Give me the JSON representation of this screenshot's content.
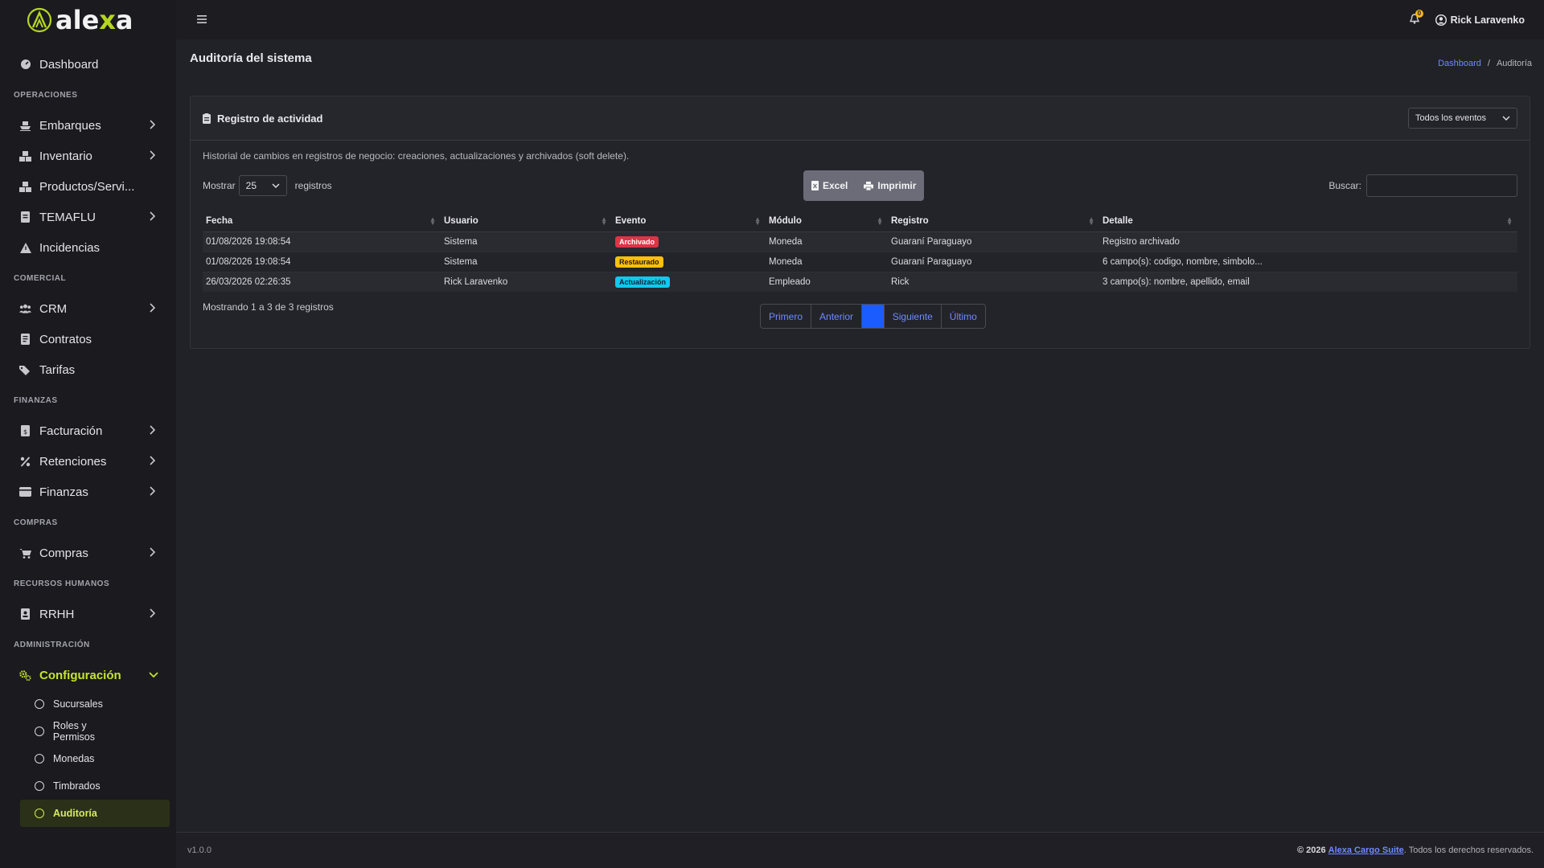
{
  "brand": {
    "name_start": "ale",
    "name_x": "x",
    "name_end": "a"
  },
  "topbar": {
    "notifications_count": "0",
    "user_name": "Rick Laravenko"
  },
  "sidebar": {
    "dashboard": "Dashboard",
    "sections": {
      "operaciones": "OPERACIONES",
      "comercial": "COMERCIAL",
      "finanzas": "FINANZAS",
      "compras": "COMPRAS",
      "rrhh": "RECURSOS HUMANOS",
      "admin": "ADMINISTRACIÓN"
    },
    "items": {
      "embarques": "Embarques",
      "inventario": "Inventario",
      "productos": "Productos/Servi...",
      "temaflu": "TEMAFLU",
      "incidencias": "Incidencias",
      "crm": "CRM",
      "contratos": "Contratos",
      "tarifas": "Tarifas",
      "facturacion": "Facturación",
      "retenciones": "Retenciones",
      "finanzas": "Finanzas",
      "compras": "Compras",
      "rrhh": "RRHH",
      "configuracion": "Configuración"
    },
    "sub": {
      "sucursales": "Sucursales",
      "roles": "Roles y Permisos",
      "monedas": "Monedas",
      "timbrados": "Timbrados",
      "auditoria": "Auditoría"
    }
  },
  "page": {
    "title": "Auditoría del sistema",
    "breadcrumb": {
      "home": "Dashboard",
      "sep": "/",
      "current": "Auditoría"
    }
  },
  "card": {
    "title": "Registro de actividad",
    "filter": "Todos los eventos",
    "description": "Historial de cambios en registros de negocio: creaciones, actualizaciones y archivados (soft delete).",
    "length": {
      "prefix": "Mostrar",
      "value": "25",
      "suffix": "registros"
    },
    "buttons": {
      "excel": "Excel",
      "print": "Imprimir"
    },
    "search_label": "Buscar:",
    "search_value": "",
    "columns": [
      "Fecha",
      "Usuario",
      "Evento",
      "Módulo",
      "Registro",
      "Detalle"
    ],
    "rows": [
      {
        "fecha": "01/08/2026 19:08:54",
        "usuario": "Sistema",
        "evento": "Archivado",
        "modulo": "Moneda",
        "registro": "Guaraní Paraguayo",
        "detalle": "Registro archivado"
      },
      {
        "fecha": "01/08/2026 19:08:54",
        "usuario": "Sistema",
        "evento": "Restaurado",
        "modulo": "Moneda",
        "registro": "Guaraní Paraguayo",
        "detalle": "6 campo(s): codigo, nombre, simbolo..."
      },
      {
        "fecha": "26/03/2026 02:26:35",
        "usuario": "Rick Laravenko",
        "evento": "Actualización",
        "modulo": "Empleado",
        "registro": "Rick",
        "detalle": "3 campo(s): nombre, apellido, email"
      }
    ],
    "info": "Mostrando 1 a 3 de 3 registros",
    "pagination": {
      "first": "Primero",
      "prev": "Anterior",
      "current": "1",
      "next": "Siguiente",
      "last": "Último"
    }
  },
  "footer": {
    "version": "v1.0.0",
    "copy_prefix": "© 2026",
    "brand_link": "Alexa Cargo Suite",
    "copy_suffix": ". Todos los derechos reservados."
  },
  "colors": {
    "accent": "#c6e52c",
    "archived": "#dc3545",
    "restored": "#ffc107",
    "updated": "#0dcaf0",
    "link": "#6f8bff",
    "page_active": "#1b5cff"
  }
}
